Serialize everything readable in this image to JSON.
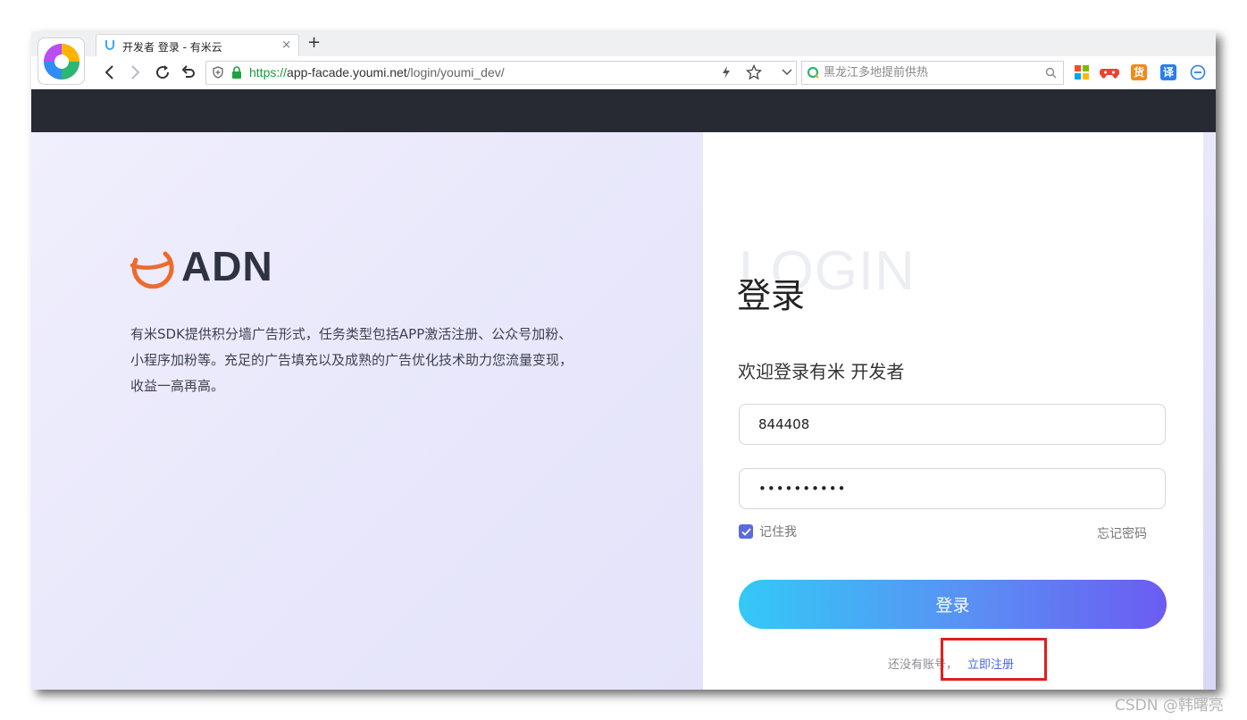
{
  "browser": {
    "tab_title": "开发者 登录 - 有米云",
    "new_tab": "+",
    "close_glyph": "×",
    "url": {
      "protocol": "https://",
      "host": "app-facade.youmi.net",
      "path": "/login/youmi_dev/"
    },
    "search_placeholder": "黑龙江多地提前供热",
    "extension_translate": "译",
    "extension_goods": "货"
  },
  "brand": {
    "name": "ADN",
    "description": "有米SDK提供积分墙广告形式，任务类型包括APP激活注册、公众号加粉、小程序加粉等。充足的广告填充以及成熟的广告优化技术助力您流量变现，收益一高再高。"
  },
  "login": {
    "watermark": "LOGIN",
    "title": "登录",
    "welcome": "欢迎登录有米 开发者",
    "username_value": "844408",
    "password_value": "••••••••••",
    "remember_label": "记住我",
    "remember_checked": true,
    "forgot_label": "忘记密码",
    "submit_label": "登录",
    "no_account_text": "还没有账号，",
    "signup_label": "立即注册"
  },
  "colors": {
    "accent": "#5a6adf",
    "button_start": "#33c9f6",
    "button_end": "#6b5cf2",
    "highlight": "#e01e1e",
    "header_dark": "#272a33"
  },
  "watermark_credit": "CSDN @韩曙亮"
}
